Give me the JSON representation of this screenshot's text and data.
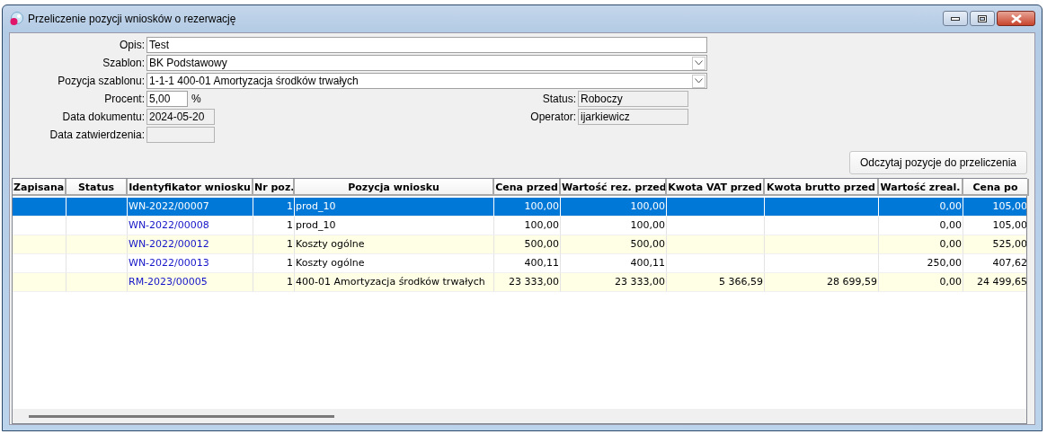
{
  "window": {
    "title": "Przeliczenie pozycji wniosków o rezerwację"
  },
  "form": {
    "rows": [
      {
        "label": "Opis:",
        "value": "Test",
        "kind": "text"
      },
      {
        "label": "Szablon:",
        "value": "BK Podstawowy",
        "kind": "combo"
      },
      {
        "label": "Pozycja szablonu:",
        "value": "1-1-1 400-01 Amortyzacja środków trwałych",
        "kind": "combo"
      }
    ],
    "left": [
      {
        "label": "Procent:",
        "value": "5,00",
        "unit": "%",
        "kind": "number"
      },
      {
        "label": "Data dokumentu:",
        "value": "2024-05-20",
        "kind": "readonly"
      },
      {
        "label": "Data zatwierdzenia:",
        "kind": "readonly"
      }
    ],
    "right": [
      {
        "label": "Status:",
        "value": "Roboczy",
        "kind": "readonly"
      },
      {
        "label": "Operator:",
        "value": "ijarkiewicz",
        "kind": "readonly"
      }
    ]
  },
  "action_button": "Odczytaj pozycje do przeliczenia",
  "table": {
    "columns": [
      {
        "title": "Zapisana",
        "kind": "text"
      },
      {
        "title": "Status",
        "kind": "text"
      },
      {
        "title": "Identyfikator wniosku",
        "kind": "link"
      },
      {
        "title": "Nr poz.",
        "kind": "number"
      },
      {
        "title": "Pozycja wniosku",
        "kind": "text"
      },
      {
        "title": "Cena przed",
        "kind": "number"
      },
      {
        "title": "Wartość rez. przed",
        "kind": "number"
      },
      {
        "title": "Kwota VAT przed",
        "kind": "number"
      },
      {
        "title": "Kwota brutto przed",
        "kind": "number"
      },
      {
        "title": "Wartość zreal.",
        "kind": "number"
      },
      {
        "title": "Cena po",
        "kind": "number"
      }
    ],
    "rows": [
      {
        "selected": true,
        "cells": [
          "",
          "",
          "WN-2022/00007",
          "1",
          "prod_10",
          "100,00",
          "100,00",
          "",
          "",
          "0,00",
          "105,00"
        ]
      },
      {
        "selected": false,
        "cells": [
          "",
          "",
          "WN-2022/00008",
          "1",
          "prod_10",
          "100,00",
          "100,00",
          "",
          "",
          "0,00",
          "105,00"
        ]
      },
      {
        "selected": false,
        "cells": [
          "",
          "",
          "WN-2022/00012",
          "1",
          "Koszty ogólne",
          "500,00",
          "500,00",
          "",
          "",
          "0,00",
          "525,00"
        ]
      },
      {
        "selected": false,
        "cells": [
          "",
          "",
          "WN-2022/00013",
          "1",
          "Koszty ogólne",
          "400,11",
          "400,11",
          "",
          "",
          "250,00",
          "407,62"
        ]
      },
      {
        "selected": false,
        "cells": [
          "",
          "",
          "RM-2023/00005",
          "1",
          "400-01 Amortyzacja środków trwałych",
          "23 333,00",
          "23 333,00",
          "5 366,59",
          "28 699,59",
          "0,00",
          "24 499,65"
        ]
      }
    ]
  }
}
